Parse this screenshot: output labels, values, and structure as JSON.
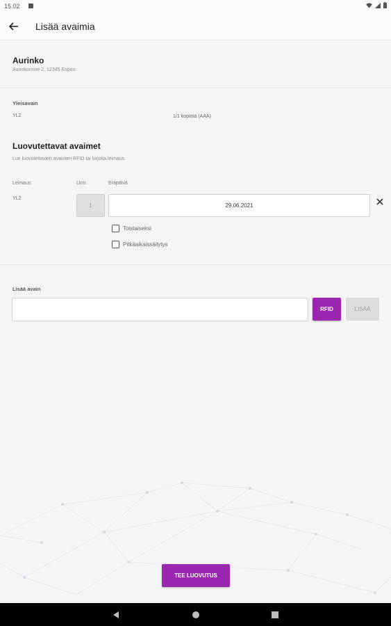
{
  "status_bar": {
    "time": "15.02"
  },
  "app_bar": {
    "title": "Lisää avaimia"
  },
  "location": {
    "name": "Aurinko",
    "address": "Aurinkorinne 2, 12345 Espoo"
  },
  "master_key": {
    "heading": "Yleisavain",
    "code": "YL2",
    "copies": "1/1 kopiota (AAA)"
  },
  "issue_keys": {
    "heading": "Luovutettavat avaimet",
    "instruction": "Lue luovutettavien avainten RFID tai kirjoita leimaus.",
    "columns": {
      "stamp": "Leimaus",
      "count": "Lkm",
      "due": "Eräpäivä"
    },
    "rows": [
      {
        "stamp": "YL2",
        "count": "1",
        "due": "29.06.2021",
        "options": [
          {
            "label": "Toistaiseksi",
            "checked": false
          },
          {
            "label": "Pitkäaikaissäilytys",
            "checked": false
          }
        ]
      }
    ]
  },
  "add_key": {
    "label": "Lisää avain",
    "input_value": "",
    "rfid_label": "RFID",
    "add_label": "LISÄÄ"
  },
  "submit": {
    "label": "TEE LUOVUTUS"
  },
  "colors": {
    "accent": "#9b27b0",
    "background": "#f5f5f5"
  }
}
